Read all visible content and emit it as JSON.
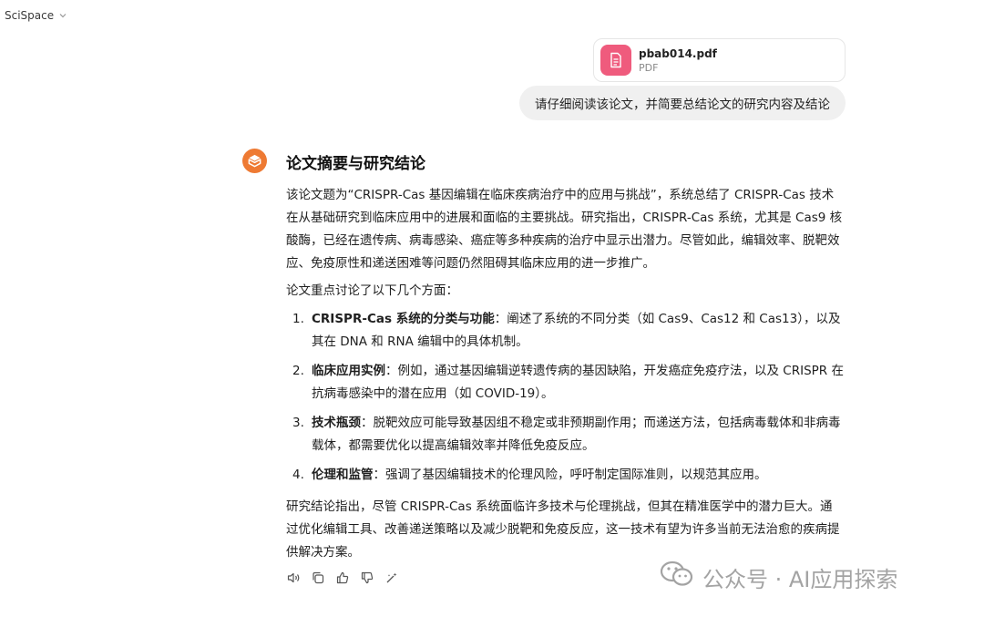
{
  "header": {
    "model_name": "SciSpace"
  },
  "attachment": {
    "file_name": "pbab014.pdf",
    "file_type": "PDF"
  },
  "user_message": "请仔细阅读该论文，并简要总结论文的研究内容及结论",
  "answer": {
    "title": "论文摘要与研究结论",
    "intro": "该论文题为“CRISPR-Cas 基因编辑在临床疾病治疗中的应用与挑战”，系统总结了 CRISPR-Cas 技术在从基础研究到临床应用中的进展和面临的主要挑战。研究指出，CRISPR-Cas 系统，尤其是 Cas9 核酸酶，已经在遗传病、病毒感染、癌症等多种疾病的治疗中显示出潜力。尽管如此，编辑效率、脱靶效应、免疫原性和递送困难等问题仍然阻碍其临床应用的进一步推广。",
    "list_lead": "论文重点讨论了以下几个方面：",
    "points": [
      {
        "num": "1.",
        "term": "CRISPR-Cas 系统的分类与功能",
        "text": "：阐述了系统的不同分类（如 Cas9、Cas12 和 Cas13），以及其在 DNA 和 RNA 编辑中的具体机制。"
      },
      {
        "num": "2.",
        "term": "临床应用实例",
        "text": "：例如，通过基因编辑逆转遗传病的基因缺陷，开发癌症免疫疗法，以及 CRISPR 在抗病毒感染中的潜在应用（如 COVID-19）。"
      },
      {
        "num": "3.",
        "term": "技术瓶颈",
        "text": "：脱靶效应可能导致基因组不稳定或非预期副作用；而递送方法，包括病毒载体和非病毒载体，都需要优化以提高编辑效率并降低免疫反应。"
      },
      {
        "num": "4.",
        "term": "伦理和监管",
        "text": "：强调了基因编辑技术的伦理风险，呼吁制定国际准则，以规范其应用。"
      }
    ],
    "conclusion": "研究结论指出，尽管 CRISPR-Cas 系统面临许多技术与伦理挑战，但其在精准医学中的潜力巨大。通过优化编辑工具、改善递送策略以及减少脱靶和免疫反应，这一技术有望为许多当前无法治愈的疾病提供解决方案。"
  },
  "actions": [
    {
      "icon": "speaker-icon"
    },
    {
      "icon": "copy-icon"
    },
    {
      "icon": "thumbs-up-icon"
    },
    {
      "icon": "thumbs-down-icon"
    },
    {
      "icon": "edit-wand-icon"
    }
  ],
  "watermark": {
    "text": "公众号 · AI应用探索"
  },
  "colors": {
    "file_icon_bg": "#ef5b7d",
    "avatar_bg": "#ee7a33",
    "user_bubble_bg": "#f0f0f0"
  }
}
